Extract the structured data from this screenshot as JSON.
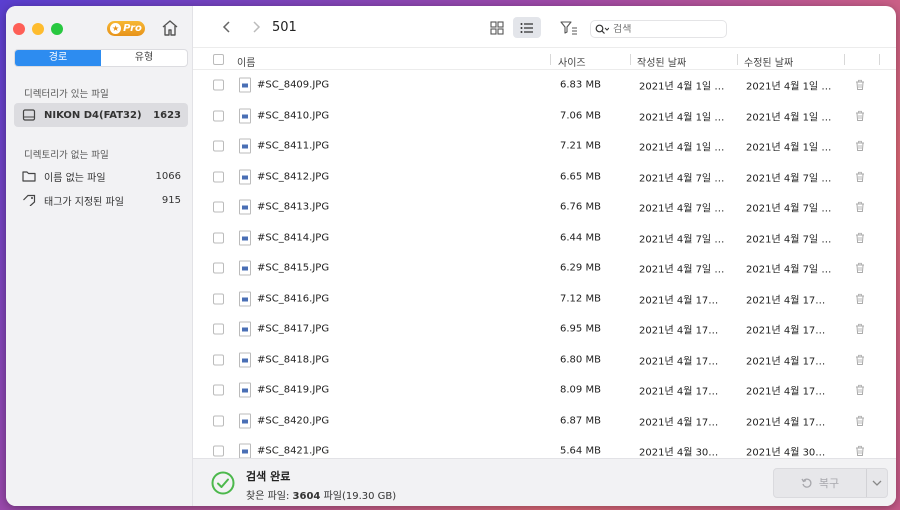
{
  "app": {
    "pro_badge": "Pro"
  },
  "sidebar": {
    "tabs": [
      {
        "label": "경로",
        "active": true
      },
      {
        "label": "유형",
        "active": false
      }
    ],
    "section_with_dir": "디렉터리가 있는 파일",
    "drives": [
      {
        "label": "NIKON D4(FAT32)",
        "count": "1623",
        "icon": "drive-icon"
      }
    ],
    "section_without_dir": "디렉토리가 없는 파일",
    "items": [
      {
        "label": "이름 없는 파일",
        "count": "1066",
        "icon": "folder-icon"
      },
      {
        "label": "태그가 지정된 파일",
        "count": "915",
        "icon": "tag-icon"
      }
    ]
  },
  "toolbar": {
    "folder_name": "501",
    "search_placeholder": "검색"
  },
  "table": {
    "headers": {
      "name": "이름",
      "size": "사이즈",
      "created": "작성된 날짜",
      "modified": "수정된 날짜"
    },
    "rows": [
      {
        "name": "#SC_8409.JPG",
        "size": "6.83 MB",
        "created": "2021년 4월 1일 오...",
        "modified": "2021년 4월 1일 오..."
      },
      {
        "name": "#SC_8410.JPG",
        "size": "7.06 MB",
        "created": "2021년 4월 1일 오...",
        "modified": "2021년 4월 1일 오..."
      },
      {
        "name": "#SC_8411.JPG",
        "size": "7.21 MB",
        "created": "2021년 4월 1일 오...",
        "modified": "2021년 4월 1일 오..."
      },
      {
        "name": "#SC_8412.JPG",
        "size": "6.65 MB",
        "created": "2021년 4월 7일 오...",
        "modified": "2021년 4월 7일 오..."
      },
      {
        "name": "#SC_8413.JPG",
        "size": "6.76 MB",
        "created": "2021년 4월 7일 오...",
        "modified": "2021년 4월 7일 오..."
      },
      {
        "name": "#SC_8414.JPG",
        "size": "6.44 MB",
        "created": "2021년 4월 7일 오...",
        "modified": "2021년 4월 7일 오..."
      },
      {
        "name": "#SC_8415.JPG",
        "size": "6.29 MB",
        "created": "2021년 4월 7일 오...",
        "modified": "2021년 4월 7일 오..."
      },
      {
        "name": "#SC_8416.JPG",
        "size": "7.12 MB",
        "created": "2021년 4월 17일 오...",
        "modified": "2021년 4월 17일 오..."
      },
      {
        "name": "#SC_8417.JPG",
        "size": "6.95 MB",
        "created": "2021년 4월 17일 오...",
        "modified": "2021년 4월 17일 오..."
      },
      {
        "name": "#SC_8418.JPG",
        "size": "6.80 MB",
        "created": "2021년 4월 17일 오...",
        "modified": "2021년 4월 17일 오..."
      },
      {
        "name": "#SC_8419.JPG",
        "size": "8.09 MB",
        "created": "2021년 4월 17일 오...",
        "modified": "2021년 4월 17일 오..."
      },
      {
        "name": "#SC_8420.JPG",
        "size": "6.87 MB",
        "created": "2021년 4월 17일 오...",
        "modified": "2021년 4월 17일 오..."
      },
      {
        "name": "#SC_8421.JPG",
        "size": "5.64 MB",
        "created": "2021년 4월 30일...",
        "modified": "2021년 4월 30일..."
      }
    ]
  },
  "status": {
    "title": "검색 완료",
    "found_prefix": "찾은 파일:",
    "found_count": "3604",
    "found_suffix": "파일(19.30 GB)",
    "recover_label": "복구"
  },
  "colors": {
    "accent": "#2d8cf0",
    "success": "#4cb84c",
    "pro": "#f0a020"
  }
}
